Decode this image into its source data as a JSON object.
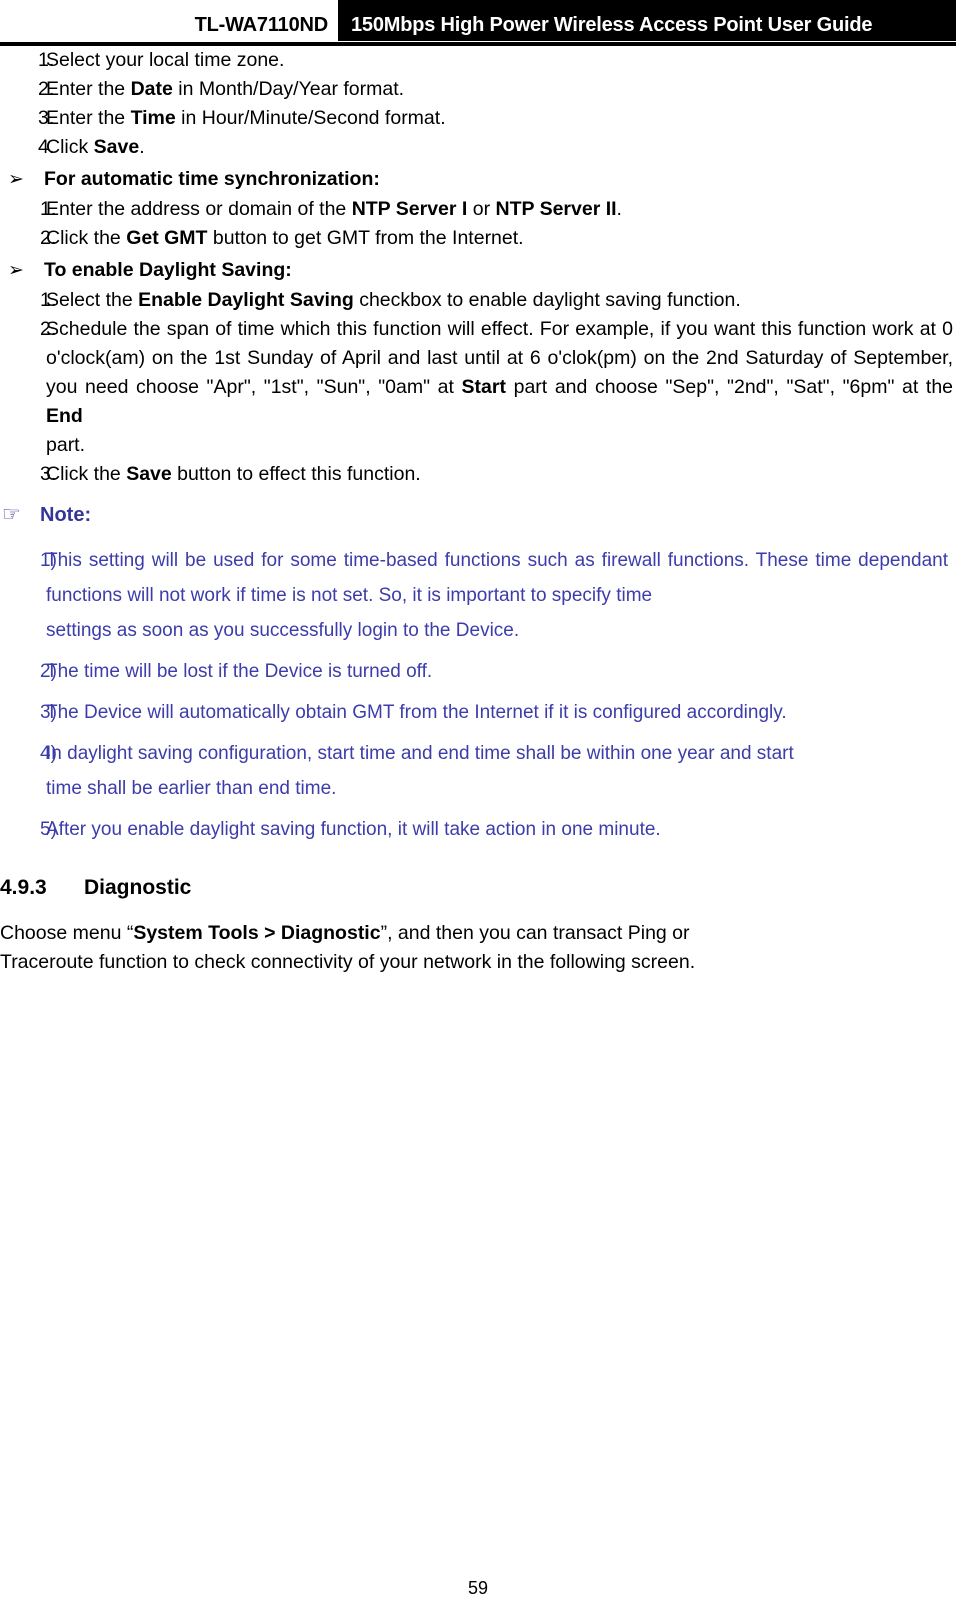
{
  "header": {
    "model": "TL-WA7110ND",
    "title": "150Mbps High Power Wireless Access Point User Guide"
  },
  "icons": {
    "arrow_bullet": "➢",
    "hand_bullet": "☞"
  },
  "colors": {
    "note_heading": "#363699",
    "note_text": "#3c3cab",
    "header_bar": "#000000",
    "header_text": "#ffffff"
  },
  "manual_steps": {
    "items": [
      {
        "num": "1.",
        "text_parts": [
          {
            "t": "Select your local time zone.",
            "b": false
          }
        ]
      },
      {
        "num": "2.",
        "text_parts": [
          {
            "t": "Enter the ",
            "b": false
          },
          {
            "t": "Date",
            "b": true
          },
          {
            "t": " in Month/Day/Year format.",
            "b": false
          }
        ]
      },
      {
        "num": "3.",
        "text_parts": [
          {
            "t": "Enter the ",
            "b": false
          },
          {
            "t": "Time",
            "b": true
          },
          {
            "t": " in Hour/Minute/Second format.",
            "b": false
          }
        ]
      },
      {
        "num": "4.",
        "text_parts": [
          {
            "t": "Click ",
            "b": false
          },
          {
            "t": "Save",
            "b": true
          },
          {
            "t": ".",
            "b": false
          }
        ]
      }
    ],
    "step1": "Select your local time zone.",
    "step2_pre": "Enter the ",
    "step2_bold": "Date",
    "step2_post": " in Month/Day/Year format.",
    "step3_pre": "Enter the ",
    "step3_bold": "Time",
    "step3_post": " in Hour/Minute/Second format.",
    "step4_pre": "Click ",
    "step4_bold": "Save",
    "step4_post": ".",
    "n1": "1.",
    "n2": "2.",
    "n3": "3.",
    "n4": "4."
  },
  "auto_sync": {
    "heading": "For automatic time synchronization:",
    "n1": "1.",
    "n2": "2.",
    "step1_pre": "Enter the address or domain of the ",
    "step1_bold1": "NTP Server I",
    "step1_mid": " or ",
    "step1_bold2": "NTP Server II",
    "step1_post": ".",
    "step2_pre": "Click the ",
    "step2_bold": "Get GMT",
    "step2_post": " button to get GMT from the Internet."
  },
  "daylight": {
    "heading": "To enable Daylight Saving:",
    "n1": "1.",
    "n2": "2.",
    "n3": "3.",
    "step1_pre": "Select the ",
    "step1_bold": "Enable Daylight Saving",
    "step1_post": " checkbox to enable daylight saving function.",
    "step2_a": " Schedule the span of time which this function will effect. For example, if you want this function work at 0 o'clock(am) on the 1st Sunday of April and last until at 6 o'clok(pm) on the 2nd Saturday of September, you need choose \"Apr\", \"1st\", \"Sun\", \"0am\" at ",
    "step2_bold1": "Start",
    "step2_b": " part and choose \"Sep\", \"2nd\", \"Sat\", \"6pm\" at the ",
    "step2_bold2": "End",
    "step2_c": " part.",
    "step3_pre": "Click the ",
    "step3_bold": "Save",
    "step3_post": " button to effect this function."
  },
  "note": {
    "label": "Note:",
    "items": [
      {
        "num": "1)",
        "text": "This setting will be used for some time-based functions such as firewall functions. These time dependant functions will not work if time is not set. So, it is important to specify time settings as soon as you successfully login to the Device."
      },
      {
        "num": "2)",
        "text": "The time will be lost if the Device is turned off."
      },
      {
        "num": "3)",
        "text": "The Device will automatically obtain GMT from the Internet if it is configured accordingly."
      },
      {
        "num": "4)",
        "text": "In daylight saving configuration, start time and end time shall be within one year and start time shall be earlier than end time."
      },
      {
        "num": "5)",
        "text": "After you enable daylight saving function, it will take action in one minute."
      }
    ],
    "n1": "1)",
    "n2": "2)",
    "n3": "3)",
    "n4": "4)",
    "n5": "5)",
    "item1_main": "This setting will be used for some time-based functions such as firewall functions. These time dependant functions will not work if time is not set. So, it is important to specify time",
    "item1_last": "settings as soon as you successfully login to the Device.",
    "item2": "The time will be lost if the Device is turned off.",
    "item3": "The Device will automatically obtain GMT from the Internet if it is configured accordingly.",
    "item4_main": "In daylight saving configuration, start time and end time shall be within one year and start",
    "item4_last": "time shall be earlier than end time.",
    "item5": "After you enable daylight saving function, it will take action in one minute."
  },
  "section": {
    "number": "4.9.3",
    "title": "Diagnostic",
    "para_pre": "Choose menu “",
    "para_bold": "System Tools > Diagnostic",
    "para_mid": "”, and then you can transact Ping or",
    "para_last": "Traceroute function to check connectivity of your network in the following screen."
  },
  "footer": {
    "page_number": "59"
  }
}
